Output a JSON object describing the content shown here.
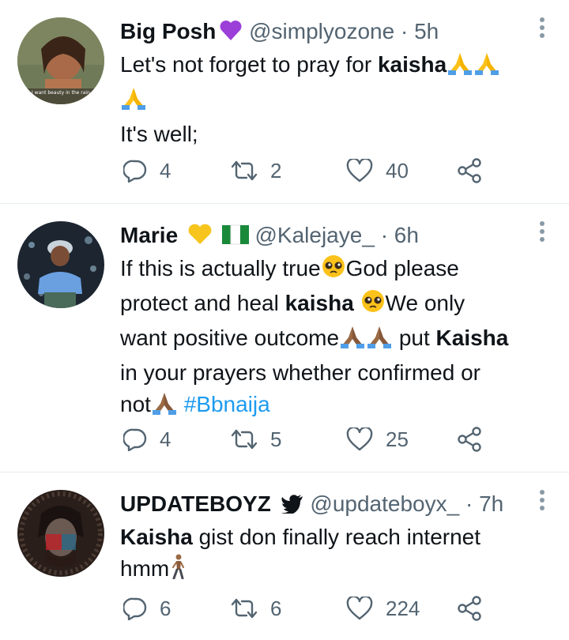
{
  "tweets": [
    {
      "display_name": "Big Posh",
      "name_emoji": "💜",
      "handle": "@simplyozone",
      "separator": "·",
      "time": "5h",
      "avatar_caption": "I want beauty in the rain",
      "lines": {
        "l1_pre": "Let's not forget to pray for ",
        "l1_bold": "kaisha",
        "l3": "It's well;"
      },
      "replies": "4",
      "retweets": "2",
      "likes": "40"
    },
    {
      "display_name": "Marie",
      "name_emoji": "💛",
      "flag": "🇳🇬",
      "handle": "@Kalejaye_",
      "separator": "·",
      "time": "6h",
      "lines": {
        "l1": "If this is actually true",
        "l1b": "God please",
        "l2_pre": "protect and heal ",
        "l2_bold": "kaisha",
        "l2_post": "We only",
        "l3": "want positive outcome",
        "l3_post": " put ",
        "l3_bold": "Kaisha",
        "l4": "in your prayers whether confirmed or",
        "l5": "not",
        "hashtag": "#Bbnaija"
      },
      "replies": "4",
      "retweets": "5",
      "likes": "25"
    },
    {
      "display_name": "UPDATEBOYZ",
      "handle": "@updateboyx_",
      "separator": "·",
      "time": "7h",
      "lines": {
        "l1_bold": "Kaisha",
        "l1_post": " gist don finally reach internet",
        "l2": "hmm"
      },
      "replies": "6",
      "retweets": "6",
      "likes": "224"
    }
  ],
  "colors": {
    "text": "#0f1419",
    "muted": "#536471",
    "link": "#1d9bf0",
    "divider": "#e6ecf0"
  },
  "icons": [
    "reply-icon",
    "retweet-icon",
    "like-icon",
    "share-icon",
    "more-icon",
    "twitter-bird-icon",
    "pray-emoji-icon",
    "pleading-emoji-icon"
  ]
}
